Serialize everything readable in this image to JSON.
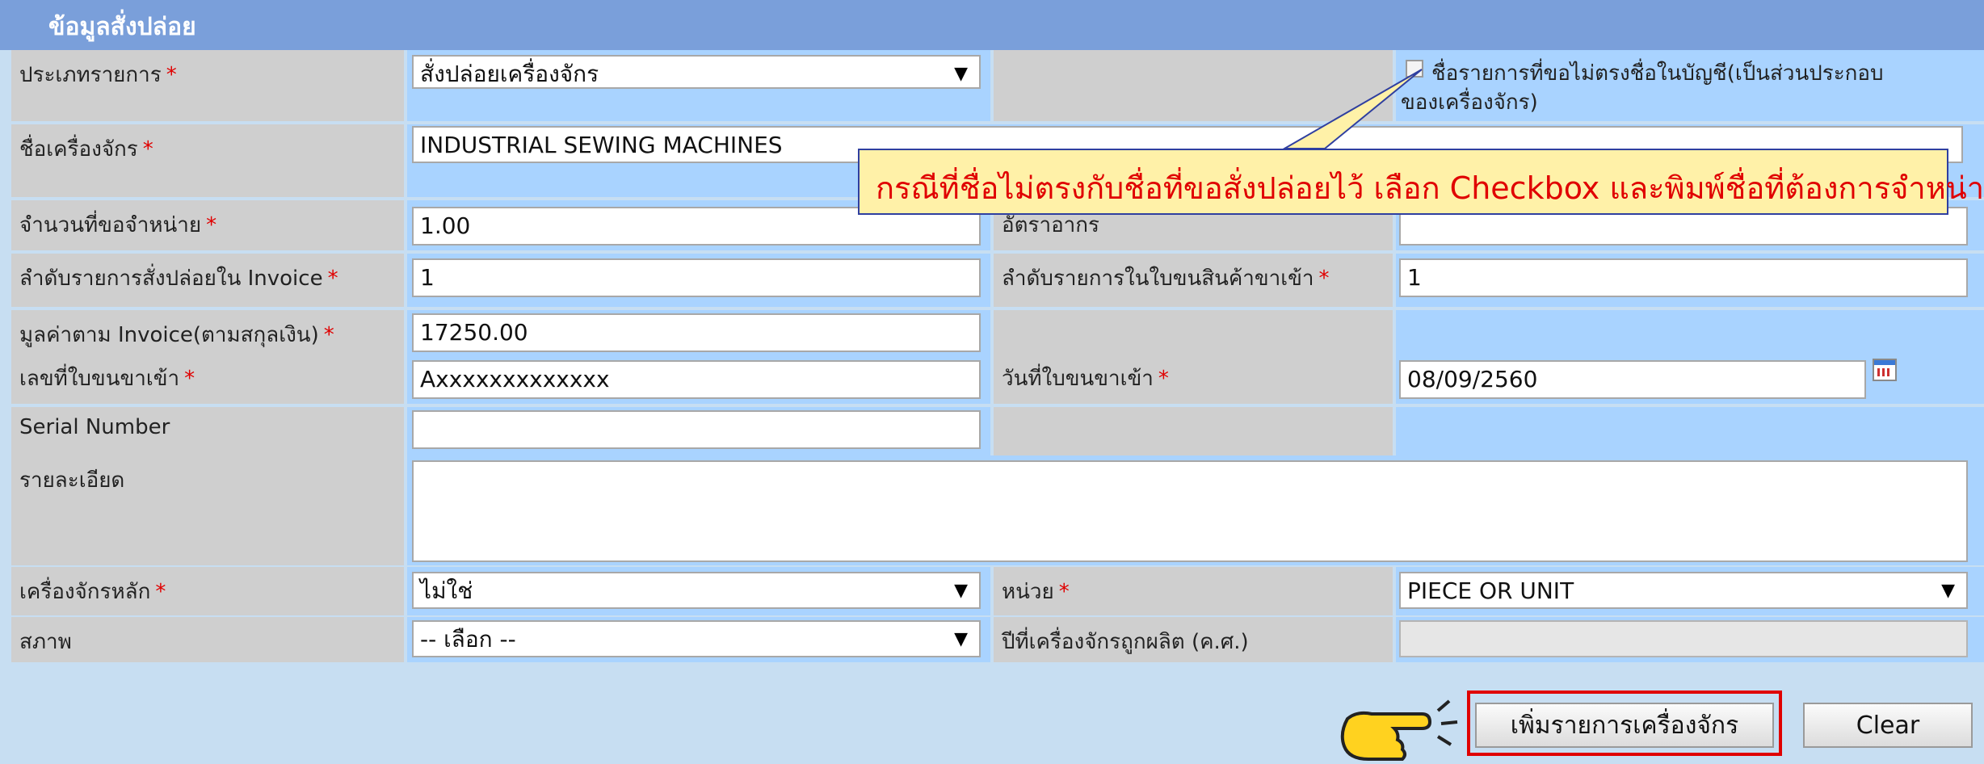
{
  "section_title": "ข้อมูลสั่งปล่อย",
  "fields": {
    "type_label": "ประเภทรายการ",
    "type_value": "สั่งปล่อยเครื่องจักร",
    "name_mismatch_label_line1": "ชื่อรายการที่ขอไม่ตรงชื่อในบัญชี(เป็นส่วนประกอบ",
    "name_mismatch_label_line2": "ของเครื่องจักร)",
    "machine_name_label": "ชื่อเครื่องจักร",
    "machine_name_value": "INDUSTRIAL SEWING MACHINES",
    "quantity_label": "จำนวนที่ขอจำหน่าย",
    "quantity_value": "1.00",
    "duty_rate_label": "อัตราอากร",
    "duty_rate_value": "",
    "invoice_order_label": "ลำดับรายการสั่งปล่อยใน Invoice",
    "invoice_order_value": "1",
    "import_order_label": "ลำดับรายการในใบขนสินค้าขาเข้า",
    "import_order_value": "1",
    "invoice_value_label": "มูลค่าตาม Invoice(ตามสกุลเงิน)",
    "invoice_value_value": "17250.00",
    "import_doc_no_label": "เลขที่ใบขนขาเข้า",
    "import_doc_no_value": "Axxxxxxxxxxxxx",
    "import_doc_date_label": "วันที่ใบขนขาเข้า",
    "import_doc_date_value": "08/09/2560",
    "serial_label": "Serial Number",
    "serial_value": "",
    "details_label": "รายละเอียด",
    "details_value": "",
    "main_machine_label": "เครื่องจักรหลัก",
    "main_machine_value": "ไม่ใช่",
    "unit_label": "หน่วย",
    "unit_value": "PIECE OR UNIT",
    "condition_label": "สภาพ",
    "condition_value": "-- เลือก --",
    "mfg_year_label": "ปีที่เครื่องจักรถูกผลิต (ค.ศ.)",
    "mfg_year_value": ""
  },
  "required_mark": "*",
  "callout_text": "กรณีที่ชื่อไม่ตรงกับชื่อที่ขอสั่งปล่อยไว้ เลือก Checkbox และพิมพ์ชื่อที่ต้องการจำหน่าย",
  "buttons": {
    "add_machine": "เพิ่มรายการเครื่องจักร",
    "clear": "Clear"
  },
  "icons": {
    "dropdown": "chevron-down-icon",
    "calendar": "calendar-icon",
    "pointer": "pointing-hand-icon"
  },
  "colors": {
    "header": "#7a9fda",
    "label_cell": "#cfcfcf",
    "value_cell": "#a9d3ff",
    "required": "#e00000",
    "callout_bg": "#fff1a8"
  }
}
